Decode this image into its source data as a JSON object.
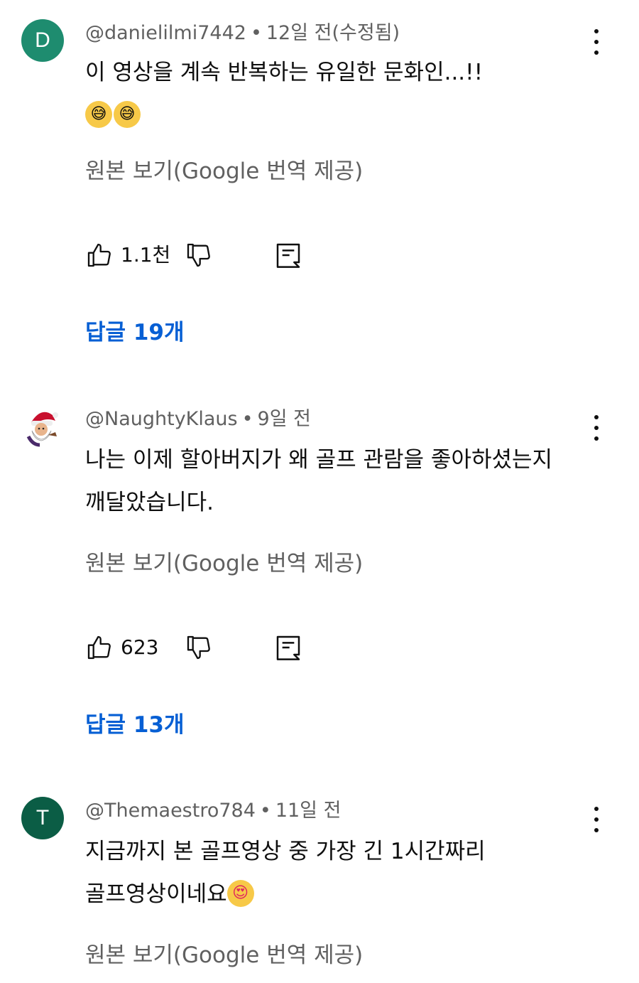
{
  "comments": [
    {
      "avatar_letter": "D",
      "avatar_color": "#1e8c6f",
      "author": "@danielilmi7442",
      "separator": "•",
      "time": "12일 전(수정됨)",
      "text_line1": "이 영상을 계속 반복하는 유일한 문화인...!!",
      "emoji_1": "😅",
      "emoji_2": "😅",
      "translate_label": "원본 보기(Google 번역 제공)",
      "like_count": "1.1천",
      "replies_label": "답글 19개"
    },
    {
      "avatar_icon": "santa-avatar-icon",
      "author": "@NaughtyKlaus",
      "separator": "•",
      "time": "9일 전",
      "text_line1": "나는 이제 할아버지가 왜 골프 관람을 좋아하셨는지",
      "text_line2": "깨달았습니다.",
      "translate_label": "원본 보기(Google 번역 제공)",
      "like_count": "623",
      "replies_label": "답글 13개"
    },
    {
      "avatar_letter": "T",
      "avatar_color": "#0b5d45",
      "author": "@Themaestro784",
      "separator": "•",
      "time": "11일 전",
      "text_line1": "지금까지 본 골프영상 중 가장 긴 1시간짜리",
      "text_line2": "골프영상이네요",
      "emoji_1": "😍",
      "translate_label": "원본 보기(Google 번역 제공)"
    }
  ]
}
